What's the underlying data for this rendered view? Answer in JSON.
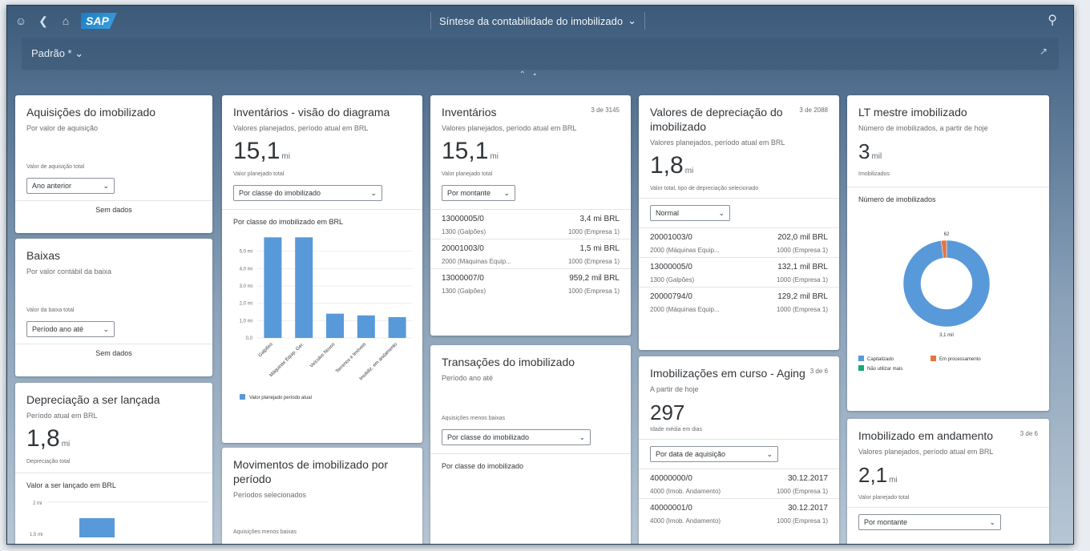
{
  "shell": {
    "title": "Síntese da contabilidade do imobilizado",
    "variant": "Padrão *"
  },
  "colors": {
    "accent": "#5899da",
    "orange": "#e8743b",
    "green": "#19a979"
  },
  "cards": {
    "aquisicoes": {
      "title": "Aquisições do imobilizado",
      "subtitle": "Por valor de aquisição",
      "kpi_label": "Valor de aquisição total",
      "select": "Ano anterior",
      "nodata": "Sem dados"
    },
    "baixas": {
      "title": "Baixas",
      "subtitle": "Por valor contábil da baixa",
      "kpi_label": "Valor da baixa total",
      "select": "Período ano até",
      "nodata": "Sem dados"
    },
    "depreciacao_lancada": {
      "title": "Depreciação a ser lançada",
      "subtitle": "Período atual em BRL",
      "kpi": "1,8",
      "unit": "mi",
      "kpi_label": "Depreciação total",
      "chart_title": "Valor a ser lançado em BRL",
      "ytick1": "2 mi",
      "ytick2": "1,5 mi"
    },
    "inventarios_diagrama": {
      "title": "Inventários - visão do diagrama",
      "subtitle": "Valores planejados, período atual em BRL",
      "kpi": "15,1",
      "unit": "mi",
      "kpi_label": "Valor planejado total",
      "select": "Por classe do imobilizado",
      "chart_title": "Por classe do imobilizado em BRL",
      "legend": "Valor planejado período atual"
    },
    "movimentos": {
      "title": "Movimentos de imobilizado por período",
      "subtitle": "Períodos selecionados",
      "kpi_label": "Aquisições menos baixas"
    },
    "inventarios": {
      "title": "Inventários",
      "count": "3 de 3145",
      "subtitle": "Valores planejados, período atual em BRL",
      "kpi": "15,1",
      "unit": "mi",
      "kpi_label": "Valor planejado total",
      "select": "Por montante",
      "rows": [
        {
          "id": "13000005/0",
          "value": "3,4 mi BRL",
          "desc": "1300 (Galpões)",
          "company": "1000 (Empresa 1)"
        },
        {
          "id": "20001003/0",
          "value": "1,5 mi BRL",
          "desc": "2000 (Máquinas Equip...",
          "company": "1000 (Empresa 1)"
        },
        {
          "id": "13000007/0",
          "value": "959,2 mil BRL",
          "desc": "1300 (Galpões)",
          "company": "1000 (Empresa 1)"
        }
      ]
    },
    "transacoes": {
      "title": "Transações do imobilizado",
      "subtitle": "Período ano até",
      "kpi_label": "Aquisições menos baixas",
      "select": "Por classe do imobilizado",
      "section": "Por classe do imobilizado"
    },
    "valores_depreciacao": {
      "title": "Valores de depreciação do imobilizado",
      "count": "3 de 2088",
      "subtitle": "Valores planejados, período atual em BRL",
      "kpi": "1,8",
      "unit": "mi",
      "kpi_label": "Valor total, tipo de depreciação selecionado",
      "select": "Normal",
      "rows": [
        {
          "id": "20001003/0",
          "value": "202,0 mil BRL",
          "desc": "2000 (Máquinas Equip...",
          "company": "1000 (Empresa 1)"
        },
        {
          "id": "13000005/0",
          "value": "132,1 mil BRL",
          "desc": "1300 (Galpões)",
          "company": "1000 (Empresa 1)"
        },
        {
          "id": "20000794/0",
          "value": "129,2 mil BRL",
          "desc": "2000 (Máquinas Equip...",
          "company": "1000 (Empresa 1)"
        }
      ]
    },
    "em_curso": {
      "title": "Imobilizações em curso - Aging",
      "count": "3 de 6",
      "subtitle": "A partir de hoje",
      "kpi": "297",
      "kpi_label": "Idade média em dias",
      "select": "Por data de aquisição",
      "rows": [
        {
          "id": "40000000/0",
          "value": "30.12.2017",
          "desc": "4000 (Imob. Andamento)",
          "company": "1000 (Empresa 1)"
        },
        {
          "id": "40000001/0",
          "value": "30.12.2017",
          "desc": "4000 (Imob. Andamento)",
          "company": "1000 (Empresa 1)"
        }
      ]
    },
    "lt_mestre": {
      "title": "LT mestre imobilizado",
      "subtitle": "Número de imobilizados, a partir de hoje",
      "kpi": "3",
      "unit": "mil",
      "kpi_label": "Imobilizados",
      "chart_title": "Número de imobilizados",
      "legend": [
        "Capitalizado",
        "Em processamento",
        "Não utilizar mais"
      ]
    },
    "andamento": {
      "title": "Imobilizado em andamento",
      "count": "3 de 6",
      "subtitle": "Valores planejados, período atual em BRL",
      "kpi": "2,1",
      "unit": "mi",
      "kpi_label": "Valor planejado total",
      "select": "Por montante"
    }
  },
  "chart_data": [
    {
      "type": "bar",
      "title": "Por classe do imobilizado em BRL",
      "categories": [
        "Galpões",
        "Máquinas Equip. Ger.",
        "Veículos Novos",
        "Terrenos e Imóveis",
        "Imobiliz. em andamento"
      ],
      "series": [
        {
          "name": "Valor planejado período atual",
          "values": [
            5.8,
            5.8,
            1.4,
            1.3,
            1.2
          ]
        }
      ],
      "yticks": [
        "0,0",
        "1,0 mi",
        "2,0 mi",
        "3,0 mi",
        "4,0 mi",
        "5,0 mi"
      ],
      "ylim": [
        0,
        6
      ],
      "grid": true
    },
    {
      "type": "pie",
      "title": "Número de imobilizados",
      "categories": [
        "Capitalizado",
        "Em processamento",
        "Não utilizar mais"
      ],
      "values": [
        3100,
        62,
        0
      ],
      "data_labels": [
        "3,1 mil",
        "62",
        ""
      ]
    }
  ]
}
